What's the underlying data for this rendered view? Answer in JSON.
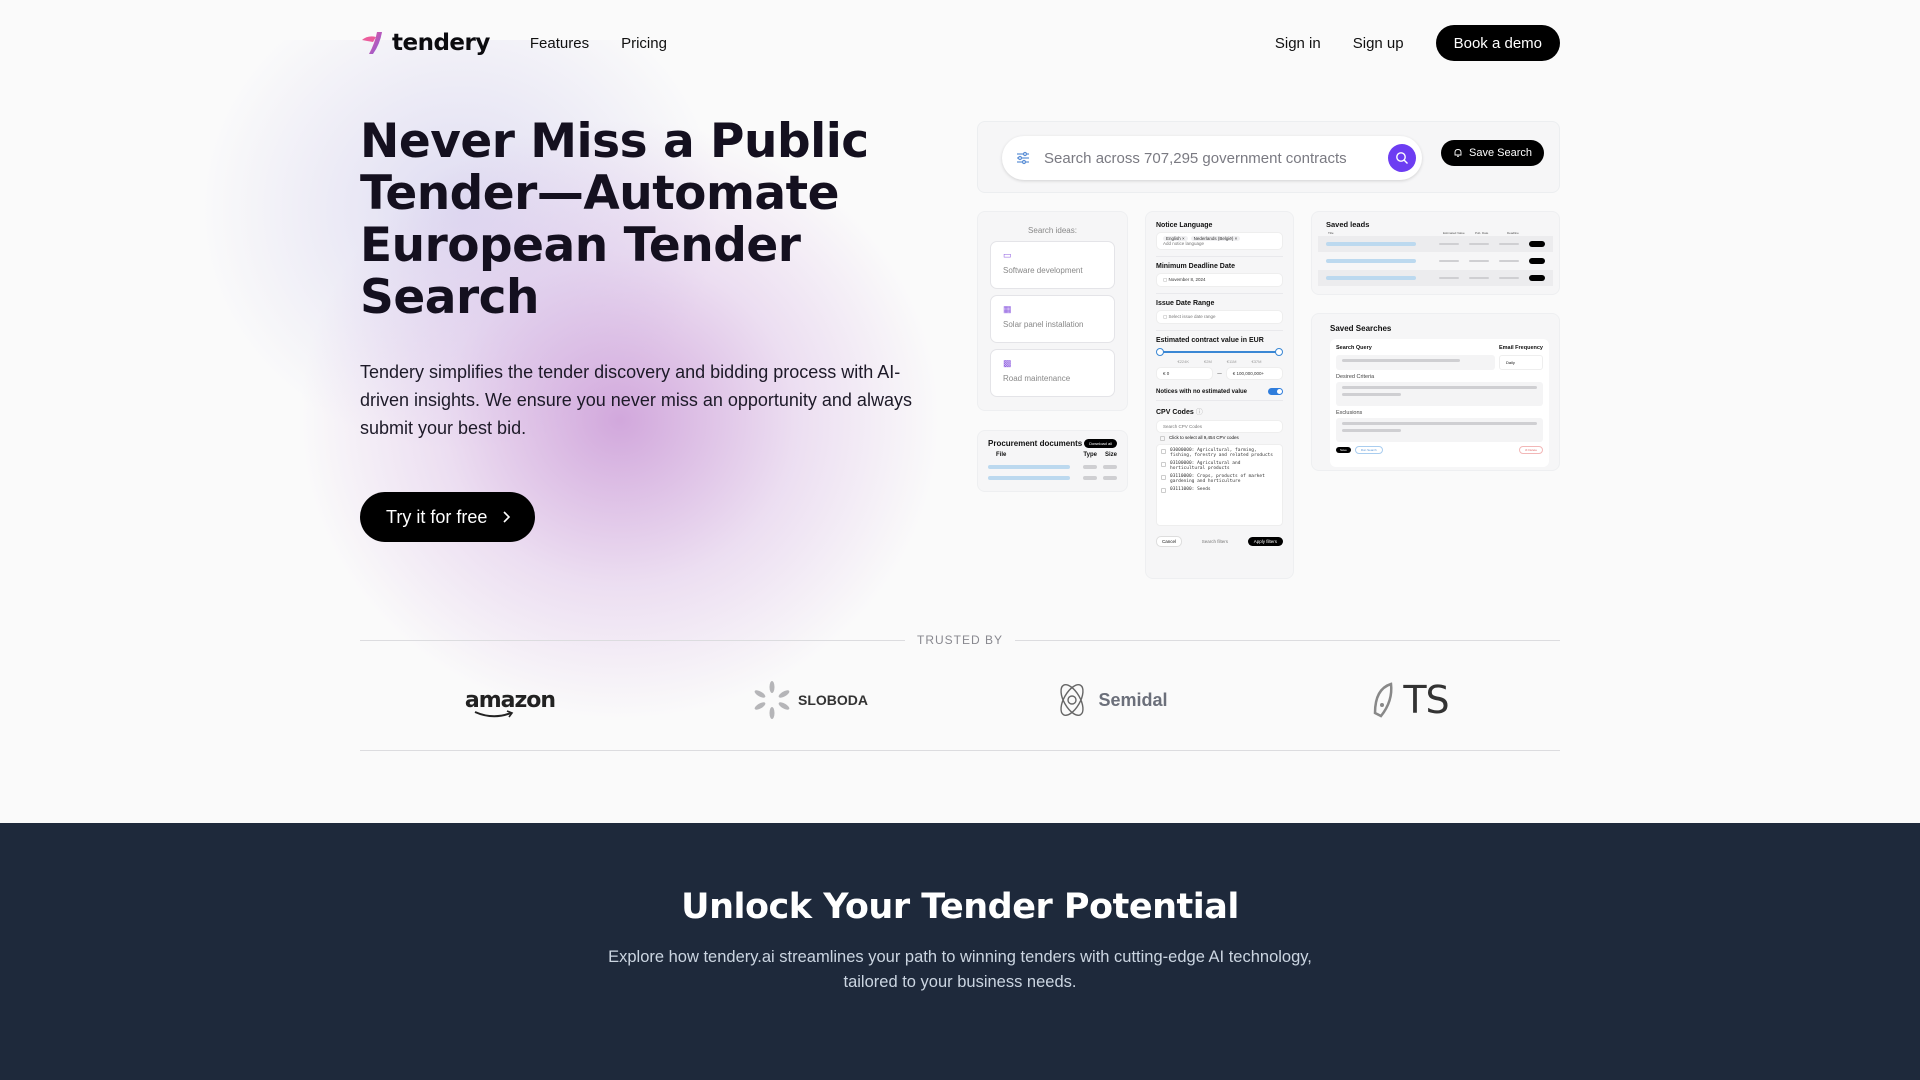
{
  "nav": {
    "brand": "tendery",
    "links": [
      "Features",
      "Pricing"
    ],
    "sign_in": "Sign in",
    "sign_up": "Sign up",
    "book_demo": "Book a demo"
  },
  "hero": {
    "title": "Never Miss a Public Tender—Automate European Tender Search",
    "description": "Tendery simplifies the tender discovery and bidding process with AI-driven insights. We ensure you never miss an opportunity and always submit your best bid.",
    "cta": "Try it for free"
  },
  "mockup": {
    "search": {
      "placeholder": "Search across 707,295 government contracts",
      "save_search": "Save Search"
    },
    "ideas": {
      "header": "Search ideas:",
      "items": [
        {
          "icon": "monitor-icon",
          "label": "Software development"
        },
        {
          "icon": "solar-panel-icon",
          "label": "Solar panel installation"
        },
        {
          "icon": "road-barrier-icon",
          "label": "Road maintenance"
        }
      ]
    },
    "documents": {
      "title": "Procurement documents",
      "download_all": "Download all",
      "columns": [
        "File",
        "Type",
        "Size"
      ]
    },
    "filters": {
      "notice_language": {
        "label": "Notice Language",
        "chips": [
          "English ×",
          "Nederlands (België) ×"
        ],
        "placeholder": "Add notice language"
      },
      "min_deadline": {
        "label": "Minimum Deadline Date",
        "value": "November 8, 2024"
      },
      "issue_range": {
        "label": "Issue Date Range",
        "placeholder": "Select issue date range"
      },
      "contract_value": {
        "label": "Estimated contract value in EUR",
        "ticks": [
          "€224K",
          "€2M",
          "€11M",
          "€37M"
        ],
        "min": "€ 0",
        "max": "€ 100,000,000+"
      },
      "no_value": {
        "label": "Notices with no estimated value",
        "enabled": true
      },
      "cpv": {
        "label": "CPV Codes",
        "search_placeholder": "Search CPV Codes",
        "select_all": "Click to select all 9,454 CPV codes",
        "items": [
          "03000000: Agricultural, farming, fishing, forestry and related products",
          "03100000: Agricultural and horticultural products",
          "03110000: Crops, products of market gardening and horticulture",
          "03111000: Seeds"
        ]
      },
      "cancel": "Cancel",
      "save_filters": "Search filters",
      "apply": "Apply filters"
    },
    "saved_leads": {
      "title": "Saved leads",
      "columns": [
        "Title",
        "Estimated Value",
        "Pub. Date",
        "Deadline"
      ]
    },
    "saved_searches": {
      "title": "Saved Searches",
      "query_label": "Search Query",
      "frequency_label": "Email Frequency",
      "frequency_value": "Daily",
      "criteria_label": "Desired Criteria",
      "exclusions_label": "Exclusions",
      "save": "Save",
      "run": "Run Search",
      "delete": "Delete"
    }
  },
  "trusted": {
    "label": "TRUSTED BY",
    "logos": [
      "amazon",
      "SLOBODA",
      "Semidal",
      "TS"
    ]
  },
  "section2": {
    "title": "Unlock Your Tender Potential",
    "subtitle": "Explore how tendery.ai streamlines your path to winning tenders with cutting-edge AI technology, tailored to your business needs."
  }
}
